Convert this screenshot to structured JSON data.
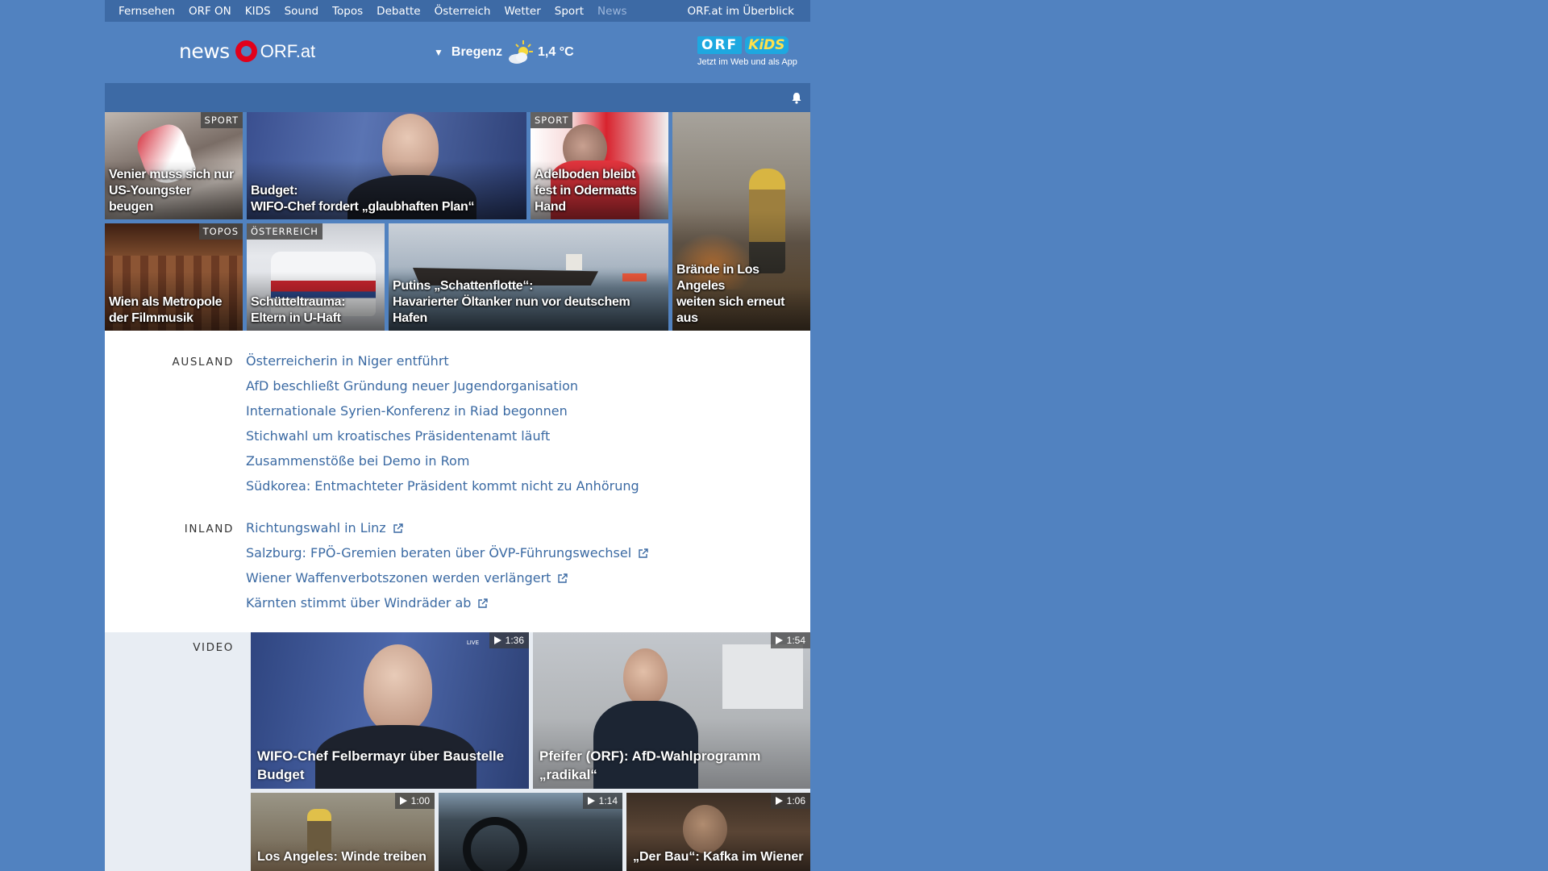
{
  "topnav": {
    "items": [
      "Fernsehen",
      "ORF ON",
      "KIDS",
      "Sound",
      "Topos",
      "Debatte",
      "Österreich",
      "Wetter",
      "Sport",
      "News"
    ],
    "active": "News",
    "overview": "ORF.at im Überblick"
  },
  "header": {
    "logo_news": "news",
    "logo_orf": "ORF.at",
    "weather": {
      "city": "Bregenz",
      "temp": "1,4 °C",
      "icon": "partly-cloudy-icon"
    },
    "kids": {
      "orf": "ORF",
      "kids": "KiDS",
      "subtitle": "Jetzt im Web und als App"
    }
  },
  "teasers": [
    {
      "tag": "SPORT",
      "caption": "Venier muss sich nur\nUS-Youngster beugen"
    },
    {
      "tag": "",
      "caption": "Budget:\nWIFO-Chef fordert „glaubhaften Plan“"
    },
    {
      "tag": "SPORT",
      "caption": "Adelboden bleibt\nfest in Odermatts Hand"
    },
    {
      "tag": "",
      "caption": "Brände in Los Angeles\nweiten sich erneut aus"
    },
    {
      "tag": "TOPOS",
      "caption": "Wien als Metropole\nder Filmmusik"
    },
    {
      "tag": "ÖSTERREICH",
      "caption": "Schütteltrauma:\nEltern in U-Haft"
    },
    {
      "tag": "",
      "caption": "Putins „Schattenflotte“:\nHavarierter Öltanker nun vor deutschem Hafen"
    }
  ],
  "ausland": {
    "label": "AUSLAND",
    "items": [
      "Österreicherin in Niger entführt",
      "AfD beschließt Gründung neuer Jugendorganisation",
      "Internationale Syrien-Konferenz in Riad begonnen",
      "Stichwahl um kroatisches Präsidentenamt läuft",
      "Zusammenstöße bei Demo in Rom",
      "Südkorea: Entmachteter Präsident kommt nicht zu Anhörung"
    ]
  },
  "inland": {
    "label": "INLAND",
    "items": [
      "Richtungswahl in Linz",
      "Salzburg: FPÖ-Gremien beraten über ÖVP-Führungswechsel",
      "Wiener Waffenverbotszonen werden verlängert",
      "Kärnten stimmt über Windräder ab"
    ]
  },
  "video": {
    "label": "VIDEO",
    "items": [
      {
        "duration": "1:36",
        "caption": "WIFO-Chef Felbermayr über Baustelle Budget",
        "live": "LIVE"
      },
      {
        "duration": "1:54",
        "caption": "Pfeifer (ORF): AfD-Wahlprogramm „radikal“"
      },
      {
        "duration": "1:00",
        "caption": "Los Angeles: Winde treiben"
      },
      {
        "duration": "1:14",
        "caption": ""
      },
      {
        "duration": "1:06",
        "caption": "„Der Bau“: Kafka im Wiener"
      }
    ]
  }
}
